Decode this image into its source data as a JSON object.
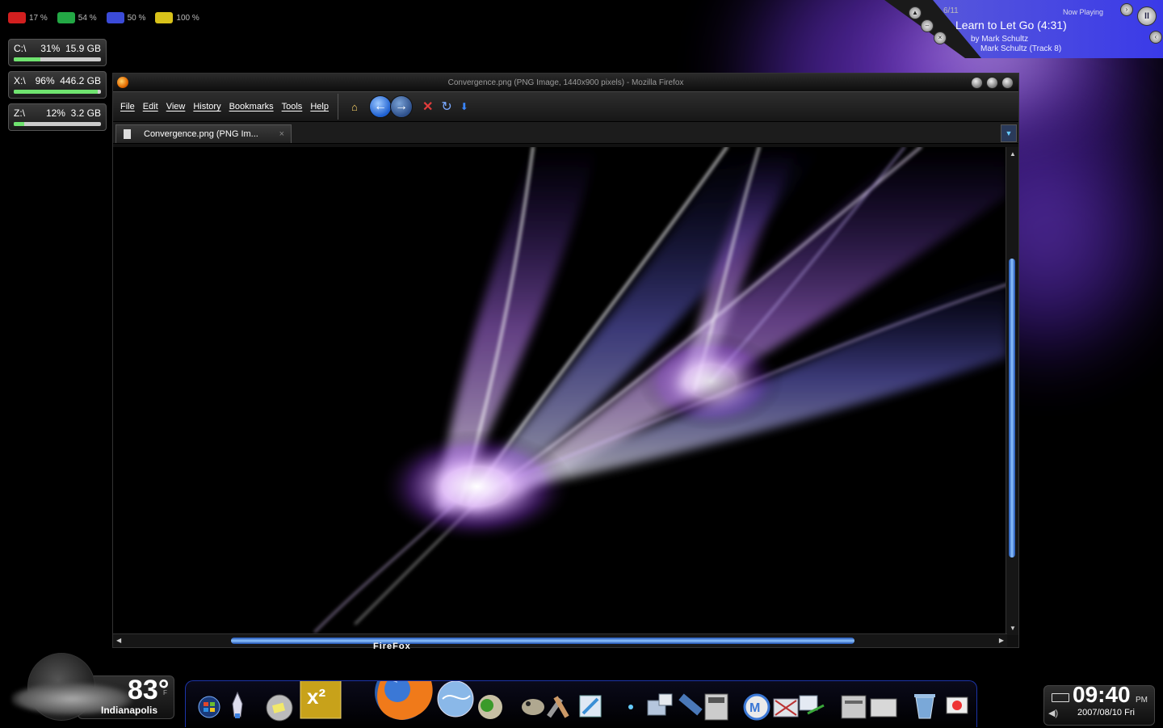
{
  "system_stats": [
    {
      "name": "cpu",
      "value": "17 %",
      "color": "#d21f1f"
    },
    {
      "name": "memory",
      "value": "54 %",
      "color": "#23a845"
    },
    {
      "name": "network",
      "value": "50 %",
      "color": "#3b4bd8"
    },
    {
      "name": "battery",
      "value": "100 %",
      "color": "#d8c21a"
    }
  ],
  "drives": [
    {
      "label": "C:\\",
      "percent": "31%",
      "size": "15.9 GB",
      "fill_fraction": 0.31
    },
    {
      "label": "X:\\",
      "percent": "96%",
      "size": "446.2 GB",
      "fill_fraction": 0.96
    },
    {
      "label": "Z:\\",
      "percent": "12%",
      "size": "3.2 GB",
      "fill_fraction": 0.12
    }
  ],
  "now_playing": {
    "track_number": "6/11",
    "header": "Now Playing",
    "title": "Learn to Let Go (4:31)",
    "artist": "by Mark Schultz",
    "album": "Mark Schultz (Track 8)",
    "pause_symbol": "II"
  },
  "firefox": {
    "title": "Convergence.png (PNG Image, 1440x900 pixels) - Mozilla Firefox",
    "menu": [
      "File",
      "Edit",
      "View",
      "History",
      "Bookmarks",
      "Tools",
      "Help"
    ],
    "toolbar_icons": [
      "home-icon",
      "back-icon",
      "forward-icon",
      "stop-icon",
      "reload-icon",
      "download-icon"
    ],
    "tab_label": "Convergence.png (PNG Im...",
    "tab_close": "×",
    "tab_list_symbol": "▼",
    "back_symbol": "←",
    "forward_symbol": "→",
    "stop_symbol": "✕",
    "reload_symbol": "↻",
    "home_symbol": "⌂",
    "down_symbol": "⬇",
    "scroll_up": "▲",
    "scroll_down": "▼",
    "scroll_left": "◀",
    "scroll_right": "▶"
  },
  "dock": {
    "hover_label": "FireFox",
    "icons": [
      "windows-start-icon",
      "rocket-icon",
      "disc-icon",
      "x2-icon",
      "firefox-icon",
      "internet-icon",
      "game-icon",
      "gimp-icon",
      "tools-icon",
      "paint-icon",
      "star-icon",
      "network-icon",
      "satellite-icon",
      "calculator-icon",
      "maxthon-icon",
      "mail-icon",
      "chat-icon",
      "explorer-icon",
      "documents-icon",
      "trash-icon",
      "media-icon"
    ]
  },
  "weather": {
    "temperature": "83°",
    "unit": "F",
    "city": "Indianapolis"
  },
  "clock": {
    "time": "09:40",
    "ampm": "PM",
    "date": "2007/08/10 Fri"
  }
}
